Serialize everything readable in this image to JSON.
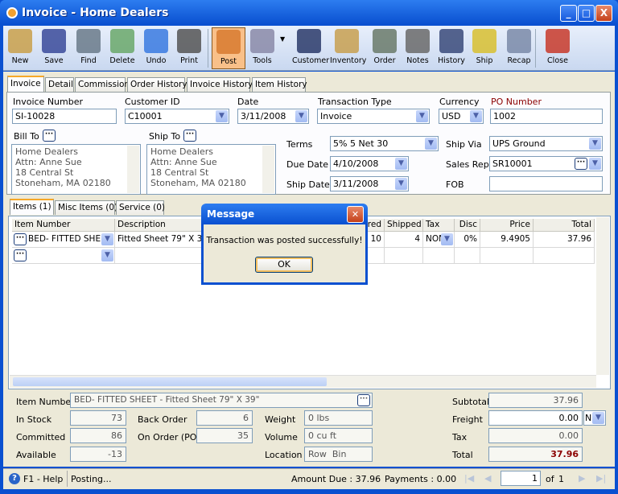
{
  "window": {
    "title": "Invoice - Home Dealers",
    "minimize": "_",
    "maximize": "□",
    "close": "X"
  },
  "toolbar": [
    {
      "label": "New",
      "icon": "new-icon"
    },
    {
      "label": "Save",
      "icon": "save-icon"
    },
    {
      "label": "Find",
      "icon": "binoculars-icon"
    },
    {
      "label": "Delete",
      "icon": "recycle-bin-icon"
    },
    {
      "label": "Undo",
      "icon": "undo-icon"
    },
    {
      "label": "Print",
      "icon": "printer-icon"
    },
    {
      "label": "Post",
      "icon": "post-icon",
      "active": true
    },
    {
      "label": "Tools",
      "icon": "tools-icon"
    },
    {
      "label": "Customer",
      "icon": "customer-icon"
    },
    {
      "label": "Inventory",
      "icon": "boxes-icon"
    },
    {
      "label": "Order",
      "icon": "pda-icon"
    },
    {
      "label": "Notes",
      "icon": "notes-icon"
    },
    {
      "label": "History",
      "icon": "history-icon"
    },
    {
      "label": "Ship",
      "icon": "forklift-icon"
    },
    {
      "label": "Recap",
      "icon": "recap-icon"
    },
    {
      "label": "Close",
      "icon": "close-window-icon"
    }
  ],
  "tabs": [
    "Invoice",
    "Detail",
    "Commission",
    "Order History",
    "Invoice History",
    "Item History"
  ],
  "form": {
    "invoice_number": {
      "label": "Invoice Number",
      "value": "SI-10028"
    },
    "customer_id": {
      "label": "Customer ID",
      "value": "C10001"
    },
    "date": {
      "label": "Date",
      "value": "3/11/2008"
    },
    "transaction_type": {
      "label": "Transaction Type",
      "value": "Invoice"
    },
    "currency": {
      "label": "Currency",
      "value": "USD"
    },
    "po_number": {
      "label": "PO Number",
      "value": "1002",
      "label_color": "#8b0000"
    },
    "bill_to": {
      "label": "Bill To",
      "lines": [
        "Home Dealers",
        "Attn: Anne Sue",
        "18 Central St",
        "Stoneham, MA 02180"
      ]
    },
    "ship_to": {
      "label": "Ship To",
      "lines": [
        "Home Dealers",
        "Attn: Anne Sue",
        "18 Central St",
        "Stoneham, MA 02180"
      ]
    },
    "terms": {
      "label": "Terms",
      "value": "5% 5 Net 30"
    },
    "due_date": {
      "label": "Due Date",
      "value": "4/10/2008"
    },
    "ship_date": {
      "label": "Ship Date",
      "value": "3/11/2008"
    },
    "ship_via": {
      "label": "Ship Via",
      "value": "UPS Ground"
    },
    "sales_rep": {
      "label": "Sales Rep",
      "value": "SR10001"
    },
    "fob": {
      "label": "FOB",
      "value": ""
    }
  },
  "item_tabs": [
    "Items (1)",
    "Misc Items (0)",
    "Service (0)"
  ],
  "grid": {
    "headers": [
      "Item Number",
      "Description",
      "Ordered",
      "Shipped",
      "Tax",
      "Disc",
      "Price",
      "Total"
    ],
    "rows": [
      [
        "BED- FITTED SHEET",
        "Fitted Sheet 79\" X 39\"",
        "10",
        "4",
        "NON",
        "0%",
        "9.4905",
        "37.96"
      ]
    ]
  },
  "details": {
    "item_number": {
      "label": "Item Number",
      "value": "BED- FITTED SHEET - Fitted Sheet 79\" X 39\""
    },
    "in_stock": {
      "label": "In Stock",
      "value": "73"
    },
    "committed": {
      "label": "Committed",
      "value": "86"
    },
    "available": {
      "label": "Available",
      "value": "-13"
    },
    "back_order": {
      "label": "Back Order",
      "value": "6"
    },
    "on_order": {
      "label": "On Order (PO)",
      "value": "35"
    },
    "weight": {
      "label": "Weight",
      "value": "0 lbs"
    },
    "volume": {
      "label": "Volume",
      "value": "0 cu ft"
    },
    "location": {
      "label": "Location",
      "value": "Row  Bin"
    }
  },
  "totals": {
    "subtotal": {
      "label": "Subtotal",
      "value": "37.96"
    },
    "freight": {
      "label": "Freight",
      "value": "0.00",
      "option": "N"
    },
    "tax": {
      "label": "Tax",
      "value": "0.00"
    },
    "total": {
      "label": "Total",
      "value": "37.96",
      "color": "#8b0000"
    }
  },
  "dialog": {
    "title": "Message",
    "message": "Transaction was posted successfully!",
    "ok": "OK"
  },
  "status": {
    "help": "F1 - Help",
    "message": "Posting...",
    "amount_due": "Amount Due : 37.96",
    "payments": "Payments : 0.00",
    "page": "1",
    "of": "of",
    "total_pages": "1"
  }
}
